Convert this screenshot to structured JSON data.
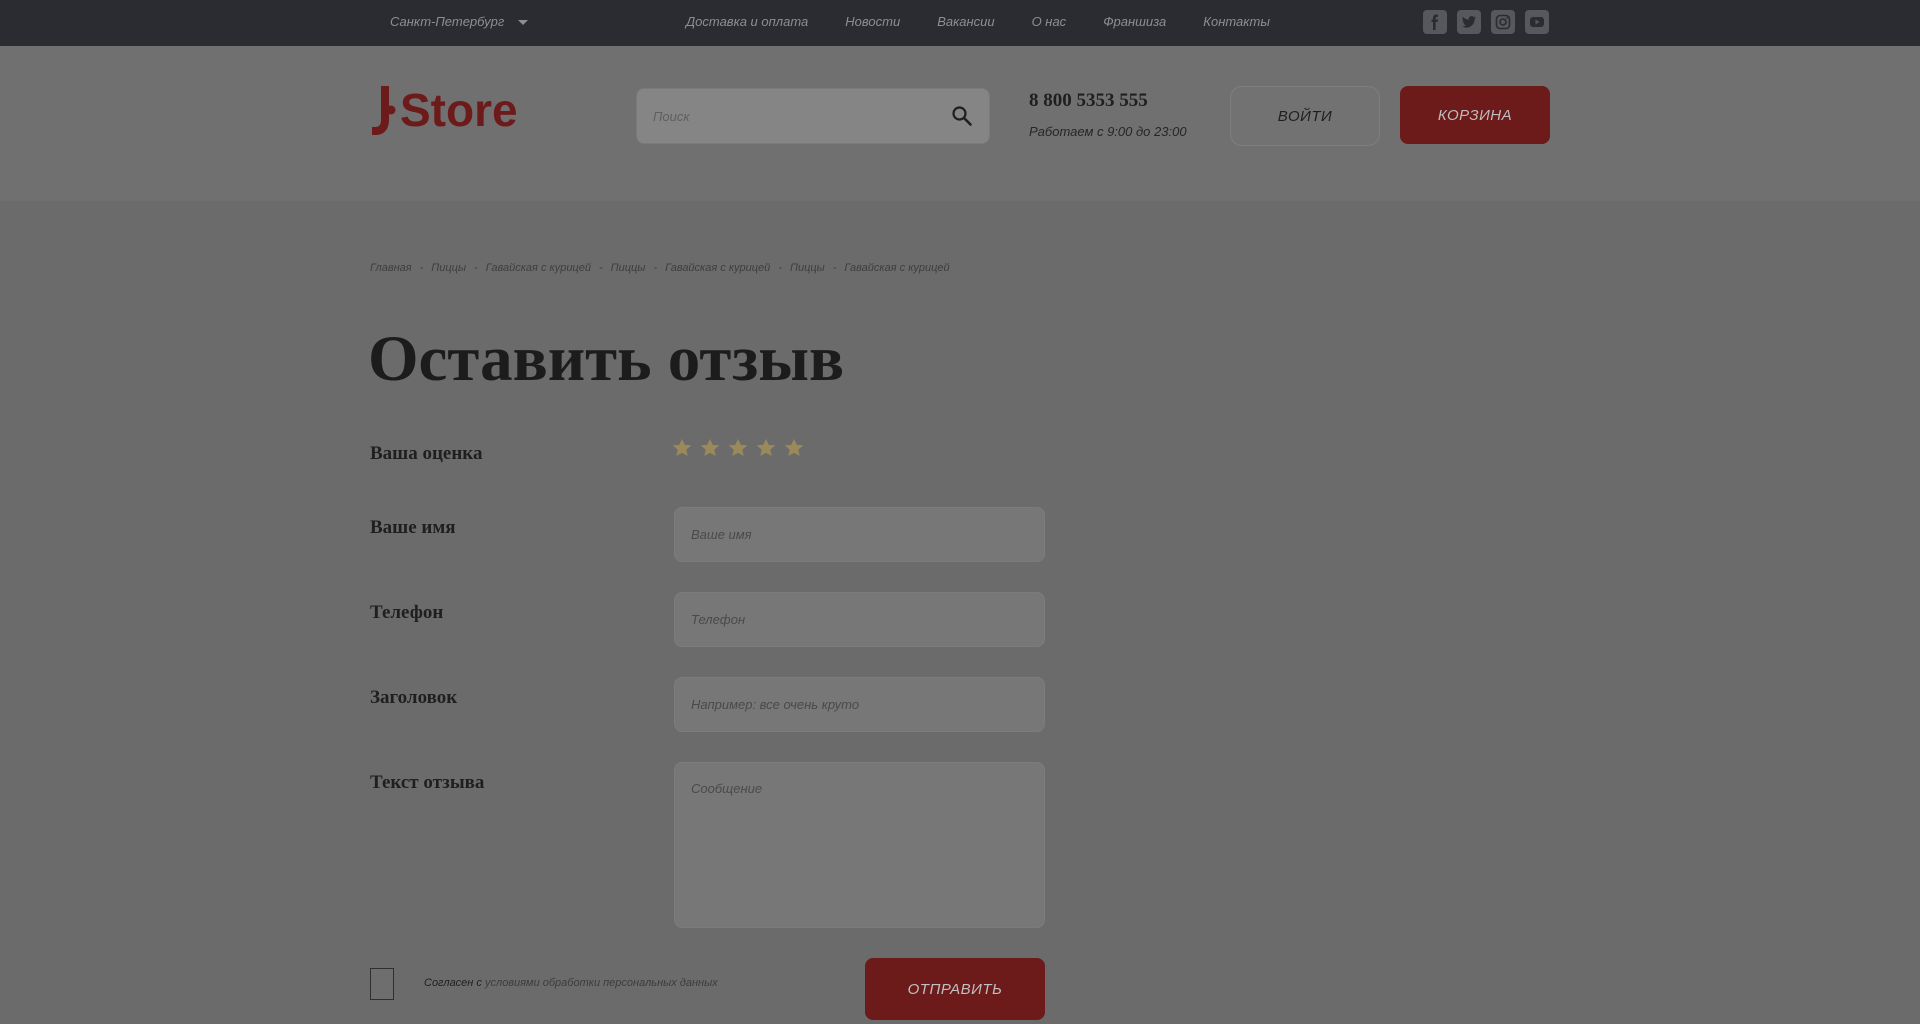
{
  "topbar": {
    "city": "Санкт-Петербург",
    "nav": [
      "Доставка и оплата",
      "Новости",
      "Вакансии",
      "О нас",
      "Франшиза",
      "Контакты"
    ],
    "social": [
      "facebook-icon",
      "twitter-icon",
      "instagram-icon",
      "youtube-icon"
    ]
  },
  "header": {
    "logo": "JStore",
    "search_placeholder": "Поиск",
    "phone": "8 800 5353 555",
    "hours": "Работаем с 9:00 до 23:00",
    "login_label": "ВОЙТИ",
    "cart_label": "КОРЗИНА"
  },
  "breadcrumb": [
    "Главная",
    "Пиццы",
    "Гавайская с курицей",
    "Пиццы",
    "Гавайская с курицей",
    "Пиццы",
    "Гавайская с курицей"
  ],
  "page_title": "Оставить отзыв",
  "form": {
    "rating_label": "Ваша оценка",
    "rating_value": 0,
    "rating_max": 5,
    "name_label": "Ваше имя",
    "name_placeholder": "Ваше имя",
    "phone_label": "Телефон",
    "phone_placeholder": "Телефон",
    "title_label": "Заголовок",
    "title_placeholder": "Например: все очень круто",
    "text_label": "Текст отзыва",
    "text_placeholder": "Сообщение",
    "consent_prefix": "Согласен с",
    "consent_link": "условиями обработки персональных данных",
    "consent_checked": false,
    "submit_label": "ОТПРАВИТЬ"
  },
  "colors": {
    "topbar_bg": "#2a2c31",
    "accent_red": "#6d1a1a",
    "star_color": "#9a8a5a"
  }
}
